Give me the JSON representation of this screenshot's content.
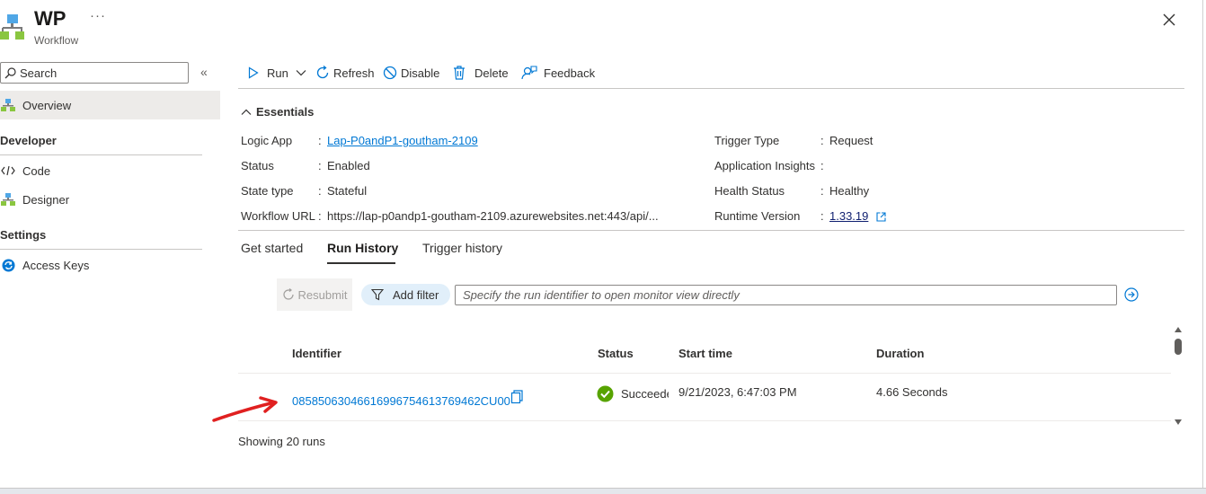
{
  "header": {
    "title": "WP",
    "subtitle": "Workflow",
    "more_label": "···"
  },
  "sidebar": {
    "search_placeholder": "Search",
    "collapse_label": "«",
    "overview": "Overview",
    "sections": [
      {
        "title": "Developer",
        "items": [
          "Code",
          "Designer"
        ]
      },
      {
        "title": "Settings",
        "items": [
          "Access Keys"
        ]
      }
    ]
  },
  "toolbar": {
    "run": "Run",
    "refresh": "Refresh",
    "disable": "Disable",
    "delete": "Delete",
    "feedback": "Feedback"
  },
  "essentials": {
    "title": "Essentials",
    "left": [
      {
        "label": "Logic App",
        "value": "Lap-P0andP1-goutham-2109"
      },
      {
        "label": "Status",
        "value": "Enabled"
      },
      {
        "label": "State type",
        "value": "Stateful"
      },
      {
        "label": "Workflow URL",
        "value": "https://lap-p0andp1-goutham-2109.azurewebsites.net:443/api/..."
      }
    ],
    "right": [
      {
        "label": "Trigger Type",
        "value": "Request"
      },
      {
        "label": "Application Insights",
        "value": ""
      },
      {
        "label": "Health Status",
        "value": "Healthy"
      },
      {
        "label": "Runtime Version",
        "value": "1.33.19"
      }
    ],
    "colon": ":"
  },
  "tabs": [
    "Get started",
    "Run History",
    "Trigger history"
  ],
  "run_history": {
    "resubmit": "Resubmit",
    "add_filter": "Add filter",
    "run_id_placeholder": "Specify the run identifier to open monitor view directly",
    "columns": [
      "Identifier",
      "Status",
      "Start time",
      "Duration"
    ],
    "rows": [
      {
        "identifier": "08585063046616996754613769462CU00",
        "status": "Succeeded",
        "start_time": "9/21/2023, 6:47:03 PM",
        "duration": "4.66 Seconds"
      }
    ],
    "footer": "Showing 20 runs"
  },
  "colors": {
    "accent": "#0078d4",
    "success": "#57a300",
    "annotation": "#e02020"
  }
}
